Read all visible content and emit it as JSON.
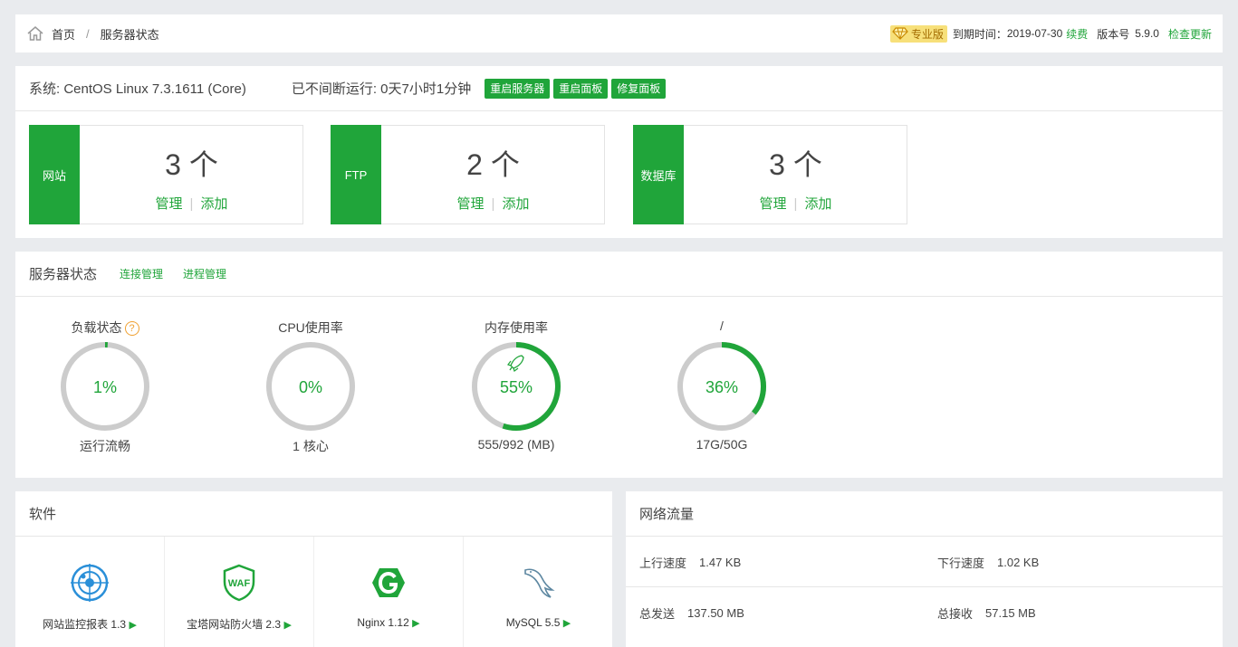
{
  "breadcrumb": {
    "home": "首页",
    "separator": "/",
    "current": "服务器状态"
  },
  "topright": {
    "edition": "专业版",
    "expire_label": "到期时间：",
    "expire_date": "2019-07-30",
    "renew": "续费",
    "version_label": "版本号",
    "version": "5.9.0",
    "check_update": "检查更新"
  },
  "system": {
    "os": "系统: CentOS Linux 7.3.1611 (Core)",
    "uptime": "已不间断运行: 0天7小时1分钟",
    "buttons": [
      "重启服务器",
      "重启面板",
      "修复面板"
    ]
  },
  "stats": [
    {
      "tag": "网站",
      "count": "3 个",
      "manage": "管理",
      "add": "添加"
    },
    {
      "tag": "FTP",
      "count": "2 个",
      "manage": "管理",
      "add": "添加"
    },
    {
      "tag": "数据库",
      "count": "3 个",
      "manage": "管理",
      "add": "添加"
    }
  ],
  "server_status": {
    "title": "服务器状态",
    "links": [
      "连接管理",
      "进程管理"
    ],
    "gauges": [
      {
        "label": "负载状态",
        "value_text": "1%",
        "percent": 1,
        "footer": "运行流畅",
        "help": "?"
      },
      {
        "label": "CPU使用率",
        "value_text": "0%",
        "percent": 0,
        "footer": "1 核心"
      },
      {
        "label": "内存使用率",
        "value_text": "55%",
        "percent": 55,
        "footer": "555/992 (MB)"
      },
      {
        "label": "/",
        "value_text": "36%",
        "percent": 36,
        "footer": "17G/50G"
      }
    ]
  },
  "software": {
    "title": "软件",
    "items": [
      {
        "name": "网站监控报表 1.3",
        "icon": "radar-icon"
      },
      {
        "name": "宝塔网站防火墙 2.3",
        "icon": "waf-shield-icon"
      },
      {
        "name": "Nginx 1.12",
        "icon": "nginx-icon"
      },
      {
        "name": "MySQL 5.5",
        "icon": "mysql-dolphin-icon"
      }
    ],
    "play_glyph": "▶"
  },
  "network": {
    "title": "网络流量",
    "up_label": "上行速度",
    "up_value": "1.47 KB",
    "down_label": "下行速度",
    "down_value": "1.02 KB",
    "sent_label": "总发送",
    "sent_value": "137.50 MB",
    "recv_label": "总接收",
    "recv_value": "57.15 MB"
  },
  "colors": {
    "accent": "#20a53a",
    "ring_bg": "#cccccc",
    "background": "#e9ebee"
  }
}
